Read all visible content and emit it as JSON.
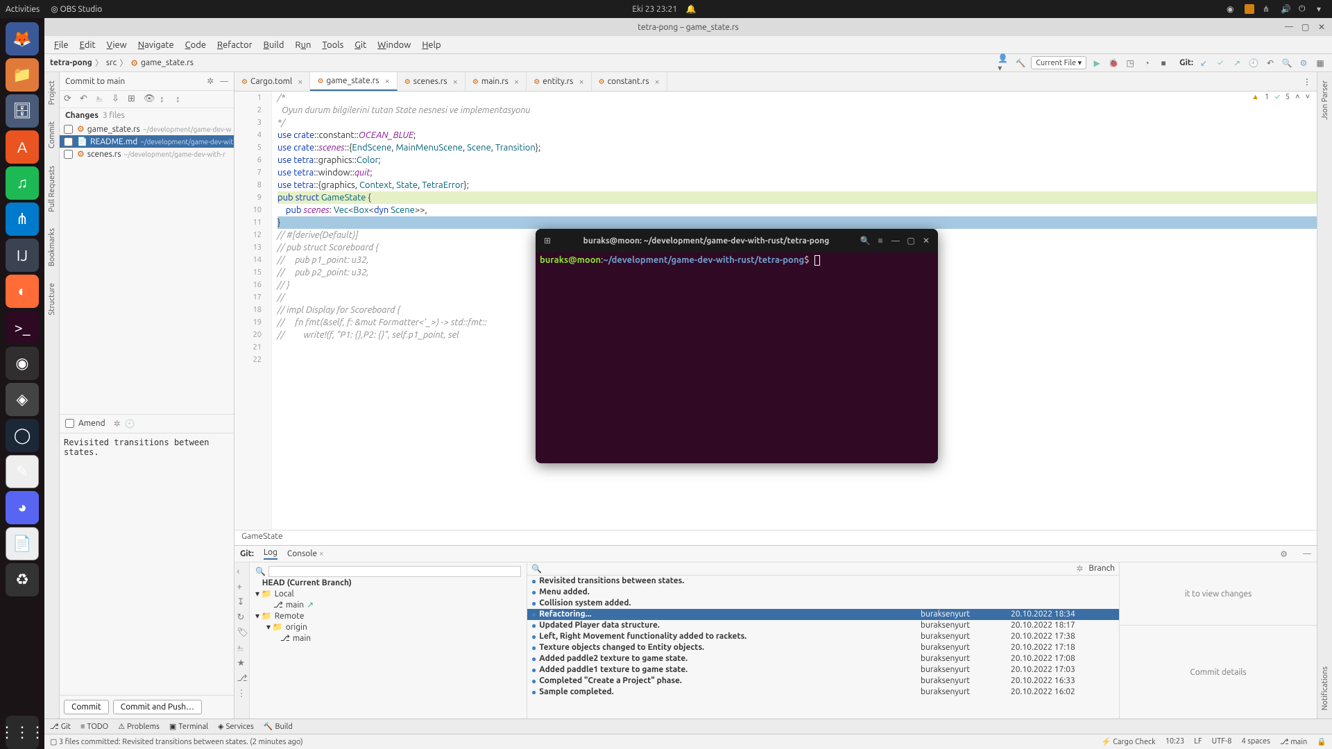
{
  "topbar": {
    "activities": "Activities",
    "app": "OBS Studio",
    "clock": "Eki 23  23:21"
  },
  "ide": {
    "title": "tetra-pong – game_state.rs",
    "menu": [
      "File",
      "Edit",
      "View",
      "Navigate",
      "Code",
      "Refactor",
      "Build",
      "Run",
      "Tools",
      "Git",
      "Window",
      "Help"
    ],
    "crumbs": {
      "project": "tetra-pong",
      "folder": "src",
      "file": "game_state.rs"
    },
    "run": {
      "config": "Current File",
      "gitlabel": "Git:"
    },
    "vtabs_left": [
      "Project",
      "Commit",
      "Pull Requests",
      "Bookmarks",
      "Structure"
    ],
    "vtabs_right": [
      "Json Parser",
      "Notifications"
    ],
    "commit": {
      "target": "Commit to main",
      "changes_label": "Changes",
      "changes_count": "3 files",
      "files": [
        {
          "name": "game_state.rs",
          "path": "~/development/game-dev-w"
        },
        {
          "name": "README.md",
          "path": "~/development/game-dev-wit"
        },
        {
          "name": "scenes.rs",
          "path": "~/development/game-dev-with-r"
        }
      ],
      "amend": "Amend",
      "message": "Revisited transitions between states.",
      "btn_commit": "Commit",
      "btn_commit_push": "Commit and Push…"
    },
    "tabs": [
      "Cargo.toml",
      "game_state.rs",
      "scenes.rs",
      "main.rs",
      "entity.rs",
      "constant.rs"
    ],
    "active_tab": 1,
    "inspections": {
      "warn": "1",
      "weak": "5"
    },
    "code_lines": [
      {
        "n": 1,
        "cm": "/*"
      },
      {
        "n": 2,
        "cm": "  Oyun durum bilgilerini tutan State nesnesi ve implementasyonu"
      },
      {
        "n": 3,
        "cm": "*/"
      },
      {
        "n": 4,
        "raw": "use crate::constant::OCEAN_BLUE;"
      },
      {
        "n": 5,
        "raw": "use crate::scenes::{EndScene, MainMenuScene, Scene, Transition};"
      },
      {
        "n": 6,
        "raw": "use tetra::graphics::Color;"
      },
      {
        "n": 7,
        "raw": "use tetra::window::quit;"
      },
      {
        "n": 8,
        "raw": "use tetra::{graphics, Context, State, TetraError};"
      },
      {
        "n": 9,
        "raw": ""
      },
      {
        "n": 10,
        "raw": "pub struct GameState {",
        "hl": true
      },
      {
        "n": 11,
        "raw": "    pub scenes: Vec<Box<dyn Scene>>,"
      },
      {
        "n": 12,
        "raw": "}",
        "sel": true
      },
      {
        "n": 13,
        "raw": ""
      },
      {
        "n": 14,
        "cm": "// #[derive(Default)]"
      },
      {
        "n": 15,
        "cm": "// pub struct Scoreboard {"
      },
      {
        "n": 16,
        "cm": "//     pub p1_point: u32,"
      },
      {
        "n": 17,
        "cm": "//     pub p2_point: u32,"
      },
      {
        "n": 18,
        "cm": "// }"
      },
      {
        "n": 19,
        "cm": "//"
      },
      {
        "n": 20,
        "cm": "// impl Display for Scoreboard {"
      },
      {
        "n": 21,
        "cm": "//     fn fmt(&self, f: &mut Formatter<'_>) -> std::fmt::"
      },
      {
        "n": 22,
        "cm": "//         write!(f, \"P1: {},P2: {}\", self.p1_point, sel"
      }
    ],
    "breadcrumb_struct": "GameState",
    "git": {
      "tabs_label": "Git:",
      "tabs": [
        "Log",
        "Console"
      ],
      "head": "HEAD (Current Branch)",
      "local": "Local",
      "remote": "Remote",
      "origin": "origin",
      "branch_main": "main",
      "branch_col": "Branch",
      "commits": [
        {
          "msg": "Revisited transitions between states.",
          "auth": "",
          "date": ""
        },
        {
          "msg": "Menu added.",
          "auth": "",
          "date": ""
        },
        {
          "msg": "Collision system added.",
          "auth": "",
          "date": ""
        },
        {
          "msg": "Refactoring...",
          "auth": "buraksenyurt",
          "date": "20.10.2022 18:34"
        },
        {
          "msg": "Updated Player data structure.",
          "auth": "buraksenyurt",
          "date": "20.10.2022 18:17"
        },
        {
          "msg": "Left, Right Movement functionality added to rackets.",
          "auth": "buraksenyurt",
          "date": "20.10.2022 17:38"
        },
        {
          "msg": "Texture objects changed to Entity objects.",
          "auth": "buraksenyurt",
          "date": "20.10.2022 17:18"
        },
        {
          "msg": "Added paddle2 texture to game state.",
          "auth": "buraksenyurt",
          "date": "20.10.2022 17:08"
        },
        {
          "msg": "Added paddle1 texture to game state.",
          "auth": "buraksenyurt",
          "date": "20.10.2022 17:03"
        },
        {
          "msg": "Completed \"Create a Project\" phase.",
          "auth": "buraksenyurt",
          "date": "20.10.2022 16:33"
        },
        {
          "msg": "Sample completed.",
          "auth": "buraksenyurt",
          "date": "20.10.2022 16:02"
        }
      ],
      "right_hint": "it to view changes",
      "right_details": "Commit details"
    },
    "toolwin": [
      "Git",
      "TODO",
      "Problems",
      "Terminal",
      "Services",
      "Build"
    ],
    "status": {
      "msg": "3 files committed: Revisited transitions between states. (2 minutes ago)",
      "cargo": "Cargo Check",
      "pos": "10:23",
      "lf": "LF",
      "enc": "UTF-8",
      "indent": "4 spaces",
      "branch": "main"
    }
  },
  "terminal": {
    "title": "buraks@moon: ~/development/game-dev-with-rust/tetra-pong",
    "user": "buraks@moon",
    "path": "~/development/game-dev-with-rust/tetra-pong"
  }
}
